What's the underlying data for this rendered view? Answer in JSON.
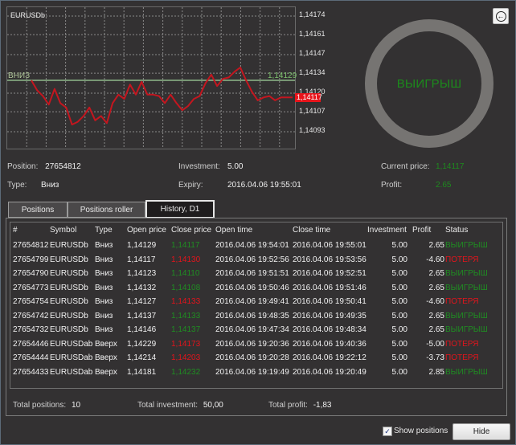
{
  "chart": {
    "symbol": "EURUSDb",
    "y_ticks": [
      "1,14174",
      "1,14161",
      "1,14147",
      "1,14134",
      "1,14120",
      "1,14107",
      "1,14093"
    ],
    "y_tick_values": [
      1.14174,
      1.14161,
      1.14147,
      1.14134,
      1.1412,
      1.14107,
      1.14093
    ],
    "level_label": "ВНИЗ",
    "level_value": 1.14129,
    "level_value_text": "1,14129",
    "current_value": 1.14117,
    "current_value_text": "1,14117",
    "price_series": [
      1.14129,
      1.14122,
      1.14118,
      1.14112,
      1.14123,
      1.14113,
      1.1411,
      1.14098,
      1.141,
      1.14104,
      1.1411,
      1.14101,
      1.14104,
      1.14099,
      1.14113,
      1.14119,
      1.14116,
      1.14126,
      1.14119,
      1.14128,
      1.14119,
      1.14119,
      1.14118,
      1.14113,
      1.14119,
      1.14113,
      1.14108,
      1.14111,
      1.14116,
      1.14118,
      1.14127,
      1.14133,
      1.14125,
      1.1413,
      1.14131,
      1.14135,
      1.14138,
      1.14129,
      1.14121,
      1.14115,
      1.14117,
      1.14118,
      1.14115,
      1.14117,
      1.14117,
      1.14117
    ],
    "colors": {
      "line": "#c4161f",
      "level": "#8fb98a",
      "current_marker": "#e8141b",
      "grid": "#8a8a8a"
    }
  },
  "result": {
    "label": "ВЫИГРЫШ",
    "back_icon": "arrow-left-circle-icon"
  },
  "info": {
    "position_label": "Position:",
    "position_value": "27654812",
    "type_label": "Type:",
    "type_value": "Вниз",
    "investment_label": "Investment:",
    "investment_value": "5.00",
    "expiry_label": "Expiry:",
    "expiry_value": "2016.04.06 19:55:01",
    "current_price_label": "Current price:",
    "current_price_value": "1,14117",
    "profit_label": "Profit:",
    "profit_value": "2.65"
  },
  "tabs": [
    {
      "label": "Positions",
      "active": false
    },
    {
      "label": "Positions roller",
      "active": false
    },
    {
      "label": "History, D1",
      "active": true
    }
  ],
  "table": {
    "columns": [
      "#",
      "Symbol",
      "Type",
      "Open price",
      "Close price",
      "Open time",
      "Close time",
      "Investment",
      "Profit",
      "Status"
    ],
    "rows": [
      {
        "id": "27654812",
        "symbol": "EURUSDb",
        "type": "Вниз",
        "open": "1,14129",
        "close": "1,14117",
        "close_color": "green",
        "open_time": "2016.04.06 19:54:01",
        "close_time": "2016.04.06 19:55:01",
        "investment": "5.00",
        "profit": "2.65",
        "status": "ВЫИГРЫШ",
        "status_color": "green"
      },
      {
        "id": "27654799",
        "symbol": "EURUSDb",
        "type": "Вниз",
        "open": "1,14117",
        "close": "1,14130",
        "close_color": "red",
        "open_time": "2016.04.06 19:52:56",
        "close_time": "2016.04.06 19:53:56",
        "investment": "5.00",
        "profit": "-4.60",
        "status": "ПОТЕРЯ",
        "status_color": "red"
      },
      {
        "id": "27654790",
        "symbol": "EURUSDb",
        "type": "Вниз",
        "open": "1,14123",
        "close": "1,14110",
        "close_color": "green",
        "open_time": "2016.04.06 19:51:51",
        "close_time": "2016.04.06 19:52:51",
        "investment": "5.00",
        "profit": "2.65",
        "status": "ВЫИГРЫШ",
        "status_color": "green"
      },
      {
        "id": "27654773",
        "symbol": "EURUSDb",
        "type": "Вниз",
        "open": "1,14132",
        "close": "1,14108",
        "close_color": "green",
        "open_time": "2016.04.06 19:50:46",
        "close_time": "2016.04.06 19:51:46",
        "investment": "5.00",
        "profit": "2.65",
        "status": "ВЫИГРЫШ",
        "status_color": "green"
      },
      {
        "id": "27654754",
        "symbol": "EURUSDb",
        "type": "Вниз",
        "open": "1,14127",
        "close": "1,14133",
        "close_color": "red",
        "open_time": "2016.04.06 19:49:41",
        "close_time": "2016.04.06 19:50:41",
        "investment": "5.00",
        "profit": "-4.60",
        "status": "ПОТЕРЯ",
        "status_color": "red"
      },
      {
        "id": "27654742",
        "symbol": "EURUSDb",
        "type": "Вниз",
        "open": "1,14137",
        "close": "1,14133",
        "close_color": "green",
        "open_time": "2016.04.06 19:48:35",
        "close_time": "2016.04.06 19:49:35",
        "investment": "5.00",
        "profit": "2.65",
        "status": "ВЫИГРЫШ",
        "status_color": "green"
      },
      {
        "id": "27654732",
        "symbol": "EURUSDb",
        "type": "Вниз",
        "open": "1,14146",
        "close": "1,14137",
        "close_color": "green",
        "open_time": "2016.04.06 19:47:34",
        "close_time": "2016.04.06 19:48:34",
        "investment": "5.00",
        "profit": "2.65",
        "status": "ВЫИГРЫШ",
        "status_color": "green"
      },
      {
        "id": "27654446",
        "symbol": "EURUSDab",
        "type": "Вверх",
        "open": "1,14229",
        "close": "1,14173",
        "close_color": "red",
        "open_time": "2016.04.06 19:20:36",
        "close_time": "2016.04.06 19:40:36",
        "investment": "5.00",
        "profit": "-5.00",
        "status": "ПОТЕРЯ",
        "status_color": "red"
      },
      {
        "id": "27654444",
        "symbol": "EURUSDab",
        "type": "Вверх",
        "open": "1,14214",
        "close": "1,14203",
        "close_color": "red",
        "open_time": "2016.04.06 19:20:28",
        "close_time": "2016.04.06 19:22:12",
        "investment": "5.00",
        "profit": "-3.73",
        "status": "ПОТЕРЯ",
        "status_color": "red"
      },
      {
        "id": "27654433",
        "symbol": "EURUSDab",
        "type": "Вверх",
        "open": "1,14181",
        "close": "1,14232",
        "close_color": "green",
        "open_time": "2016.04.06 19:19:49",
        "close_time": "2016.04.06 19:20:49",
        "investment": "5.00",
        "profit": "2.85",
        "status": "ВЫИГРЫШ",
        "status_color": "green"
      }
    ]
  },
  "totals": {
    "positions_label": "Total positions:",
    "positions_value": "10",
    "investment_label": "Total investment:",
    "investment_value": "50,00",
    "profit_label": "Total profit:",
    "profit_value": "-1,83"
  },
  "bottom": {
    "show_positions_label": "Show positions",
    "show_positions_checked": true,
    "hide_label": "Hide"
  }
}
